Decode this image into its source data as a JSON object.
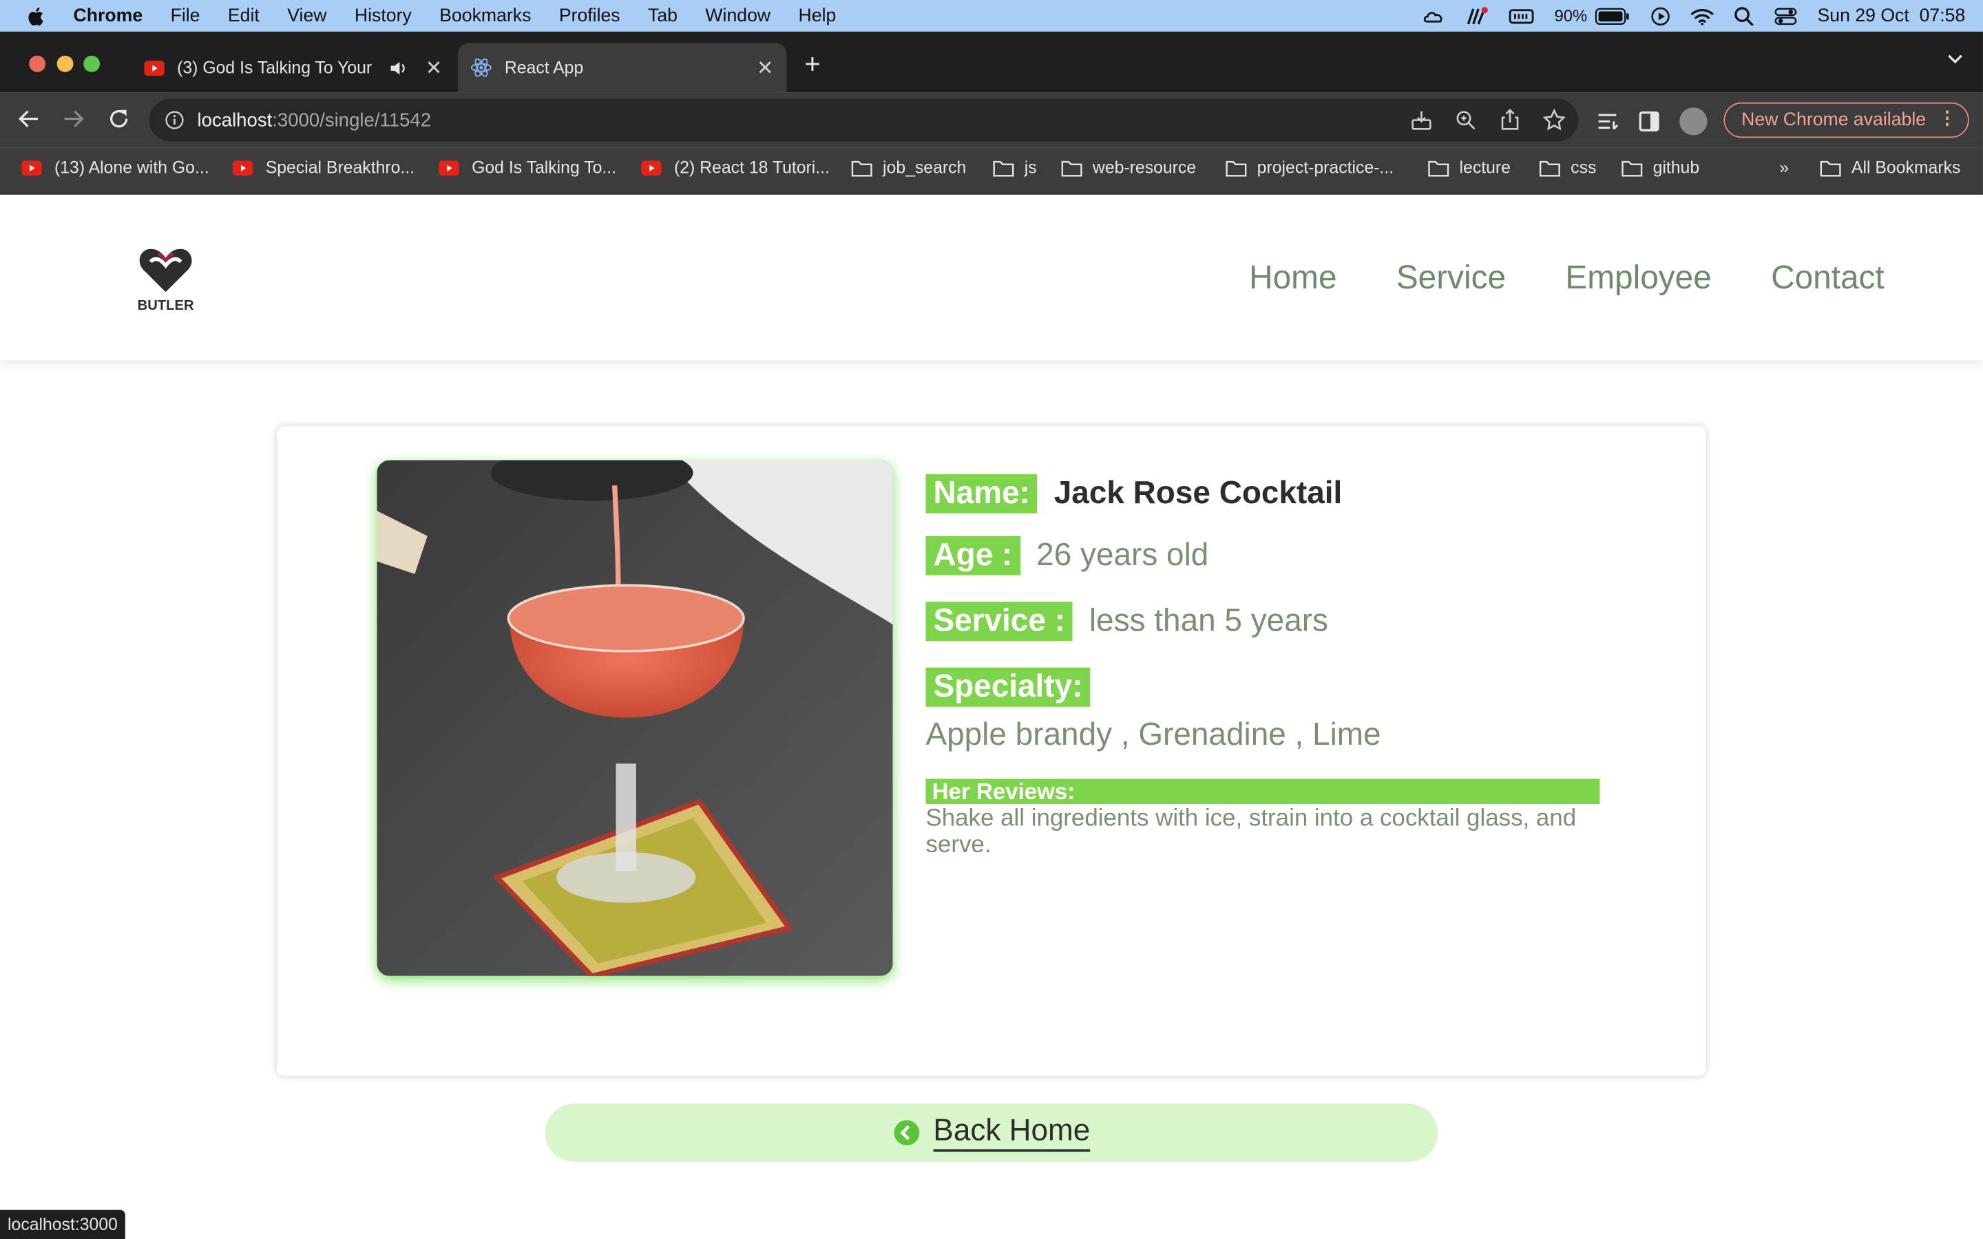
{
  "menubar": {
    "items": [
      "Chrome",
      "File",
      "Edit",
      "View",
      "History",
      "Bookmarks",
      "Profiles",
      "Tab",
      "Window",
      "Help"
    ],
    "battery": "90%",
    "datetime": "Sun 29 Oct  07:58"
  },
  "tabs": [
    {
      "title": "(3) God Is Talking To Your",
      "icon": "youtube-icon"
    },
    {
      "title": "React App",
      "icon": "react-icon"
    }
  ],
  "address": {
    "host": "localhost",
    "path": ":3000/single/11542"
  },
  "update_button": "New Chrome available",
  "bookmarks": [
    {
      "label": "(13) Alone with Go...",
      "icon": "youtube-icon"
    },
    {
      "label": "Special Breakthro...",
      "icon": "youtube-icon"
    },
    {
      "label": "God Is Talking To...",
      "icon": "youtube-icon"
    },
    {
      "label": "(2) React 18 Tutori...",
      "icon": "youtube-icon"
    },
    {
      "label": "job_search",
      "icon": "folder-icon"
    },
    {
      "label": "js",
      "icon": "folder-icon"
    },
    {
      "label": "web-resource",
      "icon": "folder-icon"
    },
    {
      "label": "project-practice-...",
      "icon": "folder-icon"
    },
    {
      "label": "lecture",
      "icon": "folder-icon"
    },
    {
      "label": "css",
      "icon": "folder-icon"
    },
    {
      "label": "github",
      "icon": "folder-icon"
    }
  ],
  "bookmarks_overflow": "»",
  "all_bookmarks": "All Bookmarks",
  "site": {
    "logo_text": "BUTLER",
    "nav": [
      "Home",
      "Service",
      "Employee",
      "Contact"
    ]
  },
  "detail": {
    "name_label": "Name:",
    "name_value": "Jack Rose Cocktail",
    "age_label": "Age :",
    "age_value": "26 years old",
    "service_label": "Service :",
    "service_value": "less than 5 years",
    "specialty_label": "Specialty:",
    "specialty_value": "Apple brandy , Grenadine , Lime",
    "reviews_label": "Her Reviews:",
    "reviews_text": "Shake all ingredients with ice, strain into a cocktail glass, and serve."
  },
  "back_home": "Back Home",
  "status_url": "localhost:3000",
  "colors": {
    "accent_green": "#7ed44b",
    "button_bg": "#d8f5cb",
    "nav_text": "#6f8a6a",
    "menubar_bg": "#a9cdf5"
  }
}
